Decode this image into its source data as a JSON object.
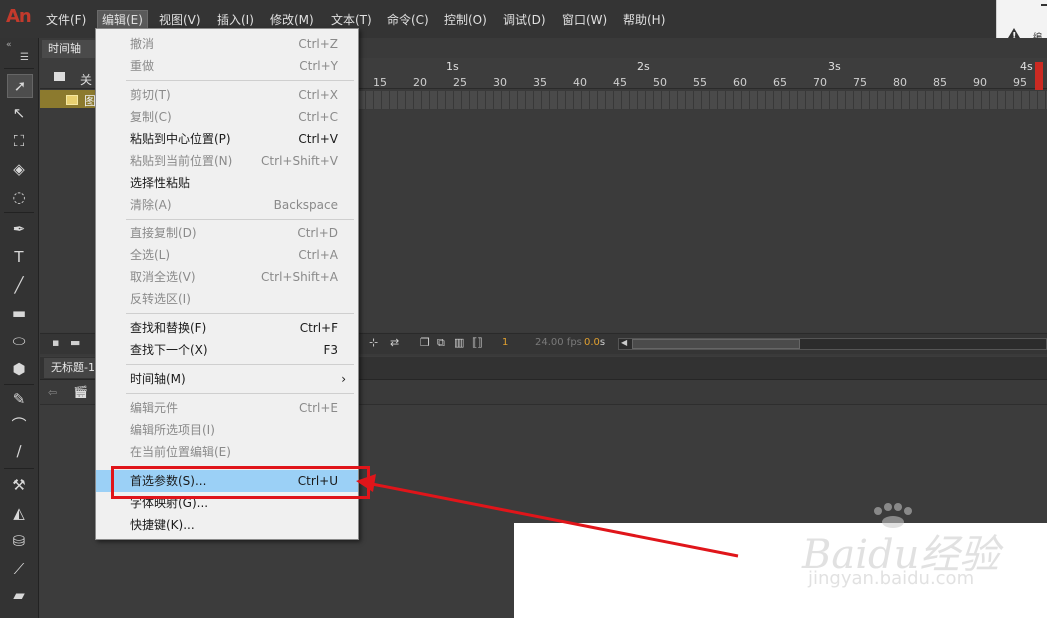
{
  "app": {
    "logo": "An"
  },
  "menubar": {
    "items": [
      {
        "label": "文件(F)"
      },
      {
        "label": "编辑(E)"
      },
      {
        "label": "视图(V)"
      },
      {
        "label": "插入(I)"
      },
      {
        "label": "修改(M)"
      },
      {
        "label": "文本(T)"
      },
      {
        "label": "命令(C)"
      },
      {
        "label": "控制(O)"
      },
      {
        "label": "调试(D)"
      },
      {
        "label": "窗口(W)"
      },
      {
        "label": "帮助(H)"
      }
    ]
  },
  "warning": {
    "text": "编"
  },
  "timeline": {
    "tab_label": "时间轴",
    "layer_label": "图",
    "hidden_label": "关",
    "ruler_seconds": [
      "1s",
      "2s",
      "3s",
      "4s"
    ],
    "ruler_frames": [
      "15",
      "20",
      "25",
      "30",
      "35",
      "40",
      "45",
      "50",
      "55",
      "60",
      "65",
      "70",
      "75",
      "80",
      "85",
      "90",
      "95"
    ],
    "footer": {
      "frame": "1",
      "fps": "24.00 fps",
      "time": "0.0",
      "time_unit": "s"
    }
  },
  "stage": {
    "tab_label": "无标题-1"
  },
  "edit_menu": {
    "items": [
      {
        "label": "撤消",
        "shortcut": "Ctrl+Z",
        "enabled": false
      },
      {
        "label": "重做",
        "shortcut": "Ctrl+Y",
        "enabled": false
      },
      {
        "label": "剪切(T)",
        "shortcut": "Ctrl+X",
        "enabled": false
      },
      {
        "label": "复制(C)",
        "shortcut": "Ctrl+C",
        "enabled": false
      },
      {
        "label": "粘贴到中心位置(P)",
        "shortcut": "Ctrl+V",
        "enabled": true
      },
      {
        "label": "粘贴到当前位置(N)",
        "shortcut": "Ctrl+Shift+V",
        "enabled": false
      },
      {
        "label": "选择性粘贴",
        "shortcut": "",
        "enabled": true
      },
      {
        "label": "清除(A)",
        "shortcut": "Backspace",
        "enabled": false
      },
      {
        "label": "直接复制(D)",
        "shortcut": "Ctrl+D",
        "enabled": false
      },
      {
        "label": "全选(L)",
        "shortcut": "Ctrl+A",
        "enabled": false
      },
      {
        "label": "取消全选(V)",
        "shortcut": "Ctrl+Shift+A",
        "enabled": false
      },
      {
        "label": "反转选区(I)",
        "shortcut": "",
        "enabled": false
      },
      {
        "label": "查找和替换(F)",
        "shortcut": "Ctrl+F",
        "enabled": true
      },
      {
        "label": "查找下一个(X)",
        "shortcut": "F3",
        "enabled": true
      },
      {
        "label": "时间轴(M)",
        "shortcut": "›",
        "enabled": true
      },
      {
        "label": "编辑元件",
        "shortcut": "Ctrl+E",
        "enabled": false
      },
      {
        "label": "编辑所选项目(I)",
        "shortcut": "",
        "enabled": false
      },
      {
        "label": "在当前位置编辑(E)",
        "shortcut": "",
        "enabled": false
      },
      {
        "label": "首选参数(S)...",
        "shortcut": "Ctrl+U",
        "enabled": true,
        "highlighted": true
      },
      {
        "label": "字体映射(G)...",
        "shortcut": "",
        "enabled": true
      },
      {
        "label": "快捷键(K)...",
        "shortcut": "",
        "enabled": true
      }
    ]
  },
  "watermark": {
    "brand": "Baidu经验",
    "url": "jingyan.baidu.com"
  },
  "colors": {
    "accent_red": "#e0151a",
    "highlight": "#9bd0f6",
    "logo": "#c33a2c"
  }
}
